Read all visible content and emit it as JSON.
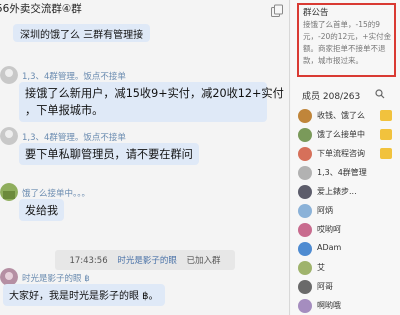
{
  "chat": {
    "title": "56外卖交流群④群",
    "messages": [
      {
        "text": "深圳的饿了么 三群有管理接"
      },
      {
        "sender": "1,3、4群管理。饭点不接单",
        "text_line1": "接饿了么新用户，减15收9+实付，减20收12+实付",
        "text_line2": "，下单报城市。"
      },
      {
        "sender": "1,3、4群管理。饭点不接单",
        "text": "要下单私聊管理员，请不要在群问"
      },
      {
        "sender": "饿了么接单中。。。",
        "text": "发给我"
      },
      {
        "sender": "时光是影子的眼 ฿",
        "text": "大家好，我是时光是影子的眼 ฿。"
      }
    ],
    "system": {
      "time": "17:43:56",
      "pre": "时光是影子的眼",
      "post": "已加入群"
    }
  },
  "notice": {
    "title": "群公告",
    "body": "接饿了么首单，-15的9元，-20的12元，+实付金额。商家拒单不接单不退款，城市报过来。"
  },
  "members": {
    "title": "成员 208/263",
    "list": [
      {
        "name": "收钱、饿了么",
        "color": "#c0853a"
      },
      {
        "name": "饿了么接单中",
        "color": "#7a9a5a"
      },
      {
        "name": "下单流程咨询",
        "color": "#d6705a"
      },
      {
        "name": "1,3、4群管理",
        "color": "#b2b2b2"
      },
      {
        "name": "爱上錶步...",
        "color": "#5d5d6b"
      },
      {
        "name": "阿炳",
        "color": "#8bb2d8"
      },
      {
        "name": "哎哟呵",
        "color": "#c86b8e"
      },
      {
        "name": "ADam",
        "color": "#4e8bd1"
      },
      {
        "name": "艾",
        "color": "#9fb36c"
      },
      {
        "name": "阿哥",
        "color": "#6a6a6a"
      },
      {
        "name": "啊哟哦",
        "color": "#a58dbf"
      }
    ]
  },
  "colors": {
    "accent": "#d93a33",
    "bubble": "#dfe9f7",
    "link": "#4b73a8"
  }
}
